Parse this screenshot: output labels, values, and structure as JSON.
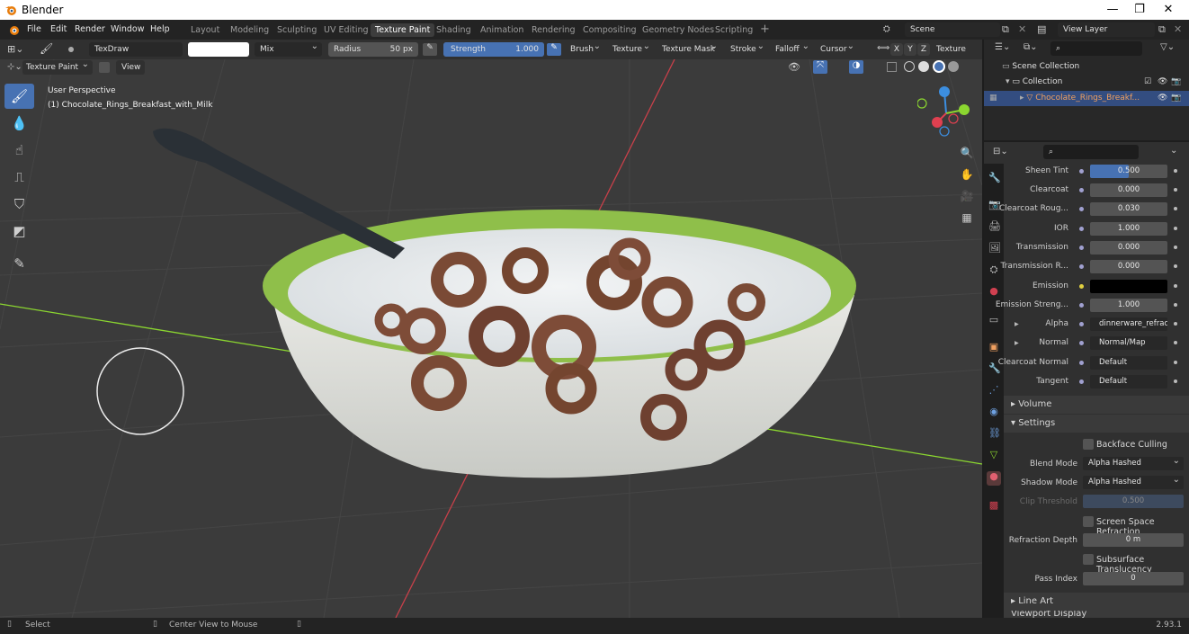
{
  "app": {
    "title": "Blender",
    "version": "2.93.1"
  },
  "window_controls": {
    "minimize": "—",
    "maximize": "❐",
    "close": "✕"
  },
  "menu": [
    "File",
    "Edit",
    "Render",
    "Window",
    "Help"
  ],
  "workspaces": [
    "Layout",
    "Modeling",
    "Sculpting",
    "UV Editing",
    "Texture Paint",
    "Shading",
    "Animation",
    "Rendering",
    "Compositing",
    "Geometry Nodes",
    "Scripting"
  ],
  "active_workspace": "Texture Paint",
  "scene": {
    "name": "Scene",
    "view_layer": "View Layer"
  },
  "tool_header": {
    "brush_name": "TexDraw",
    "blend": "Mix",
    "radius_label": "Radius",
    "radius_value": "50 px",
    "strength_label": "Strength",
    "strength_value": "1.000",
    "strength_fill": 1.0,
    "menus": [
      "Brush",
      "Texture",
      "Texture Mask",
      "Stroke",
      "Falloff",
      "Cursor"
    ],
    "axes": [
      "X",
      "Y",
      "Z"
    ],
    "texture_slots": "Texture Slots"
  },
  "viewport_header": {
    "mode": "Texture Paint",
    "view": "View"
  },
  "viewport": {
    "perspective": "User Perspective",
    "object_label": "(1) Chocolate_Rings_Breakfast_with_Milk"
  },
  "outliner": {
    "scene_collection": "Scene Collection",
    "collection": "Collection",
    "object": "Chocolate_Rings_Breakf..."
  },
  "properties": {
    "rows": [
      {
        "label": "Sheen Tint",
        "value": "0.500",
        "fill": 0.5
      },
      {
        "label": "Clearcoat",
        "value": "0.000"
      },
      {
        "label": "Clearcoat Roug...",
        "value": "0.030"
      },
      {
        "label": "IOR",
        "value": "1.000"
      },
      {
        "label": "Transmission",
        "value": "0.000"
      },
      {
        "label": "Transmission R...",
        "value": "0.000"
      },
      {
        "label": "Emission",
        "value": ""
      },
      {
        "label": "Emission Streng...",
        "value": "1.000"
      },
      {
        "label": "Alpha",
        "value": "dinnerware_refracti..."
      },
      {
        "label": "Normal",
        "value": "Normal/Map"
      },
      {
        "label": "Clearcoat Normal",
        "value": "Default"
      },
      {
        "label": "Tangent",
        "value": "Default"
      }
    ],
    "sections": {
      "volume": "Volume",
      "settings": "Settings",
      "line_art": "Line Art",
      "viewport_display": "Viewport Display"
    },
    "settings": {
      "backface_culling": "Backface Culling",
      "blend_mode_label": "Blend Mode",
      "blend_mode": "Alpha Hashed",
      "shadow_mode_label": "Shadow Mode",
      "shadow_mode": "Alpha Hashed",
      "clip_threshold_label": "Clip Threshold",
      "clip_threshold": "0.500",
      "ssr": "Screen Space Refraction",
      "refraction_depth_label": "Refraction Depth",
      "refraction_depth": "0 m",
      "subsurface": "Subsurface Translucency",
      "pass_index_label": "Pass Index",
      "pass_index": "0"
    }
  },
  "statusbar": {
    "select": "Select",
    "center": "Center View to Mouse"
  },
  "colors": {
    "accent": "#4772b3",
    "bowl_rim": "#8fbf4a",
    "milk": "#e8ecee",
    "cereal": "#7a4a35",
    "x_axis": "#e04050",
    "y_axis": "#8bd630",
    "z_axis": "#3c8ee0"
  }
}
